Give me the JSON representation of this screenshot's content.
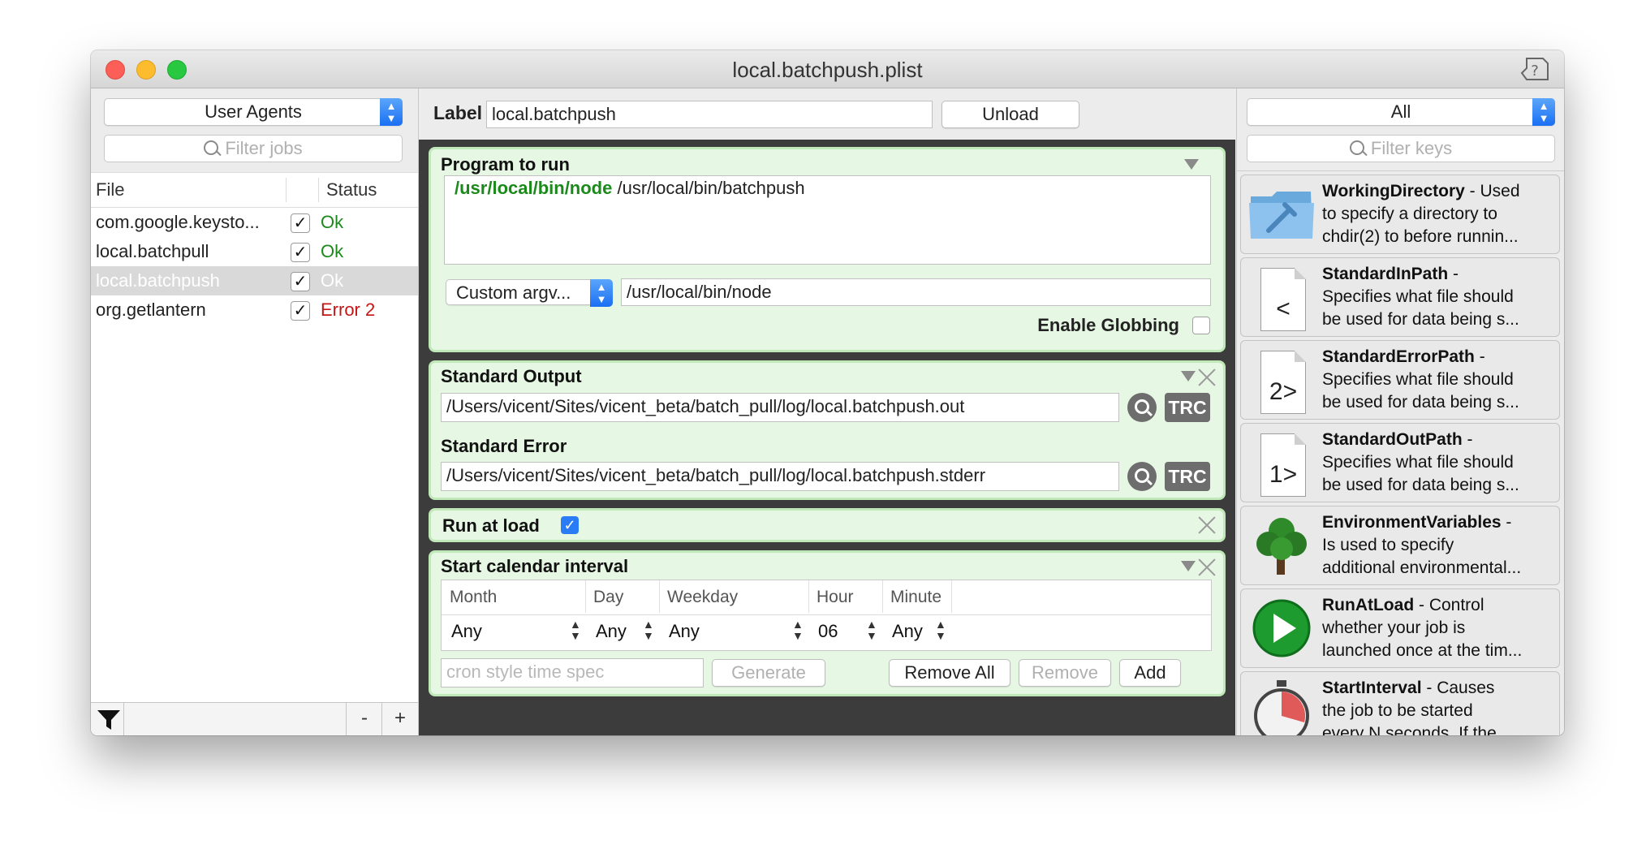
{
  "window": {
    "title": "local.batchpush.plist"
  },
  "left": {
    "domain_popup": "User Agents",
    "filter_placeholder": "Filter jobs",
    "columns": {
      "file": "File",
      "status": "Status"
    },
    "jobs": [
      {
        "file": "com.google.keysto...",
        "checked": "✓",
        "status": "Ok"
      },
      {
        "file": "local.batchpull",
        "checked": "✓",
        "status": "Ok"
      },
      {
        "file": "local.batchpush",
        "checked": "✓",
        "status": "Ok"
      },
      {
        "file": "org.getlantern",
        "checked": "✓",
        "status": "Error 2"
      }
    ],
    "footer": {
      "remove": "-",
      "add": "+"
    }
  },
  "center": {
    "label_caption": "Label",
    "label_value": "local.batchpush",
    "unload": "Unload",
    "program": {
      "title": "Program to run",
      "executable": "/usr/local/bin/node",
      "args": " /usr/local/bin/batchpush",
      "argv_popup": "Custom argv...",
      "argv_value": "/usr/local/bin/node",
      "globbing_label": "Enable Globbing"
    },
    "output": {
      "stdout_title": "Standard Output",
      "stdout_path": "/Users/vicent/Sites/vicent_beta/batch_pull/log/local.batchpush.out",
      "stderr_title": "Standard Error",
      "stderr_path": "/Users/vicent/Sites/vicent_beta/batch_pull/log/local.batchpush.stderr",
      "trc": "TRC"
    },
    "runatload": {
      "title": "Run at load",
      "checked": "✓"
    },
    "calendar": {
      "title": "Start calendar interval",
      "headers": {
        "month": "Month",
        "day": "Day",
        "weekday": "Weekday",
        "hour": "Hour",
        "minute": "Minute"
      },
      "row": {
        "month": "Any",
        "day": "Any",
        "weekday": "Any",
        "hour": "06",
        "minute": "Any"
      },
      "stepper": "⌃⌄",
      "cron_placeholder": "cron style time spec",
      "generate": "Generate",
      "remove_all": "Remove All",
      "remove": "Remove",
      "add": "Add"
    }
  },
  "right": {
    "category_popup": "All",
    "filter_placeholder": "Filter keys",
    "keys": [
      {
        "name": "WorkingDirectory",
        "l1": " - Used",
        "l2": "to specify a directory to",
        "l3": "chdir(2) to before runnin...",
        "icon": "folder-icon"
      },
      {
        "name": "StandardInPath",
        "l1": " -",
        "l2": "Specifies what file should",
        "l3": "be used for data being s...",
        "icon": "document-icon",
        "glyph": "<"
      },
      {
        "name": "StandardErrorPath",
        "l1": " -",
        "l2": "Specifies what file should",
        "l3": "be used for data being s...",
        "icon": "document-icon",
        "glyph": "2>"
      },
      {
        "name": "StandardOutPath",
        "l1": " -",
        "l2": "Specifies what file should",
        "l3": "be used for data being s...",
        "icon": "document-icon",
        "glyph": "1>"
      },
      {
        "name": "EnvironmentVariables",
        "l1": " -",
        "l2": "Is used to specify",
        "l3": "additional environmental...",
        "icon": "tree-icon"
      },
      {
        "name": "RunAtLoad",
        "l1": " - Control",
        "l2": "whether your job is",
        "l3": "launched once at the tim...",
        "icon": "play-icon"
      },
      {
        "name": "StartInterval",
        "l1": " - Causes",
        "l2": "the job to be started",
        "l3": "every N seconds.  If the...",
        "icon": "stopwatch-icon"
      }
    ]
  },
  "colors": {
    "panel_bg": "#e6f7e3",
    "panel_border": "#c1e8b9",
    "ok": "#1b8a1b",
    "error": "#c41616",
    "accent": "#2a7cf6"
  }
}
